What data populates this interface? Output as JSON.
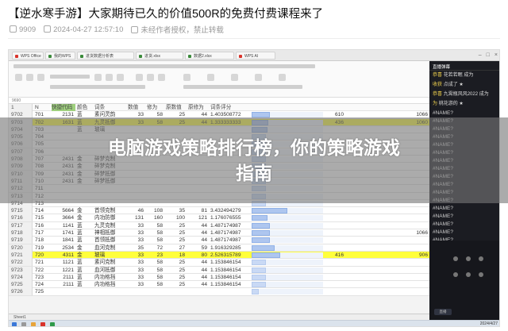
{
  "post": {
    "title": "【逆水寒手游】大家期待已久的价值500R的免费付费课程来了",
    "views": "9909",
    "date": "2024-04-27 12:57:10",
    "copyright": "未经作者授权，禁止转载"
  },
  "overlay": {
    "line1": "电脑游戏策略排行榜，你的策略游戏",
    "line2": "指南"
  },
  "tabs": [
    "WPS Office",
    "我的WPS",
    "进货数据分析表",
    "进货.xlsx",
    "数据2.xlsx",
    "WPS AI"
  ],
  "cell_ref": "9690",
  "header_row": {
    "rn": "1",
    "cols": [
      "N",
      "快捷代码",
      "颜色",
      "词条",
      "数值",
      "修为",
      "原数值",
      "原修为",
      "词条评分",
      "",
      "",
      "",
      ""
    ]
  },
  "rows": [
    {
      "rn": "9702",
      "n": "701",
      "code": "2131",
      "color": "蓝",
      "word": "素问灵韵",
      "v1": "33",
      "v2": "58",
      "v3": "25",
      "v4": "44",
      "score": "1.403508772",
      "bar": 0.25,
      "x1": "610",
      "x2": "1066",
      "hl": false
    },
    {
      "rn": "9703",
      "n": "702",
      "code": "1631",
      "color": "蓝",
      "word": "九灵抵御",
      "v1": "33",
      "v2": "58",
      "v3": "25",
      "v4": "44",
      "score": "1.333333333",
      "bar": 0.23,
      "x1": "436",
      "x2": "1060",
      "hl": true
    },
    {
      "rn": "9704",
      "n": "703",
      "code": "",
      "color": "蓝",
      "word": "玻璃",
      "v1": "",
      "v2": "",
      "v3": "",
      "v4": "",
      "score": "",
      "bar": 0.22,
      "x1": "",
      "x2": "",
      "hl": false
    },
    {
      "rn": "9705",
      "n": "704",
      "code": "",
      "color": "",
      "word": "",
      "v1": "",
      "v2": "",
      "v3": "",
      "v4": "",
      "score": "",
      "bar": 0.2,
      "x1": "",
      "x2": "",
      "hl": false
    },
    {
      "rn": "9706",
      "n": "705",
      "code": "",
      "color": "",
      "word": "",
      "v1": "",
      "v2": "",
      "v3": "",
      "v4": "",
      "score": "",
      "bar": 0.2,
      "x1": "",
      "x2": "",
      "hl": false
    },
    {
      "rn": "9707",
      "n": "706",
      "code": "",
      "color": "",
      "word": "",
      "v1": "",
      "v2": "",
      "v3": "",
      "v4": "",
      "score": "",
      "bar": 0.2,
      "x1": "",
      "x2": "",
      "hl": false
    },
    {
      "rn": "9708",
      "n": "707",
      "code": "2431",
      "color": "金",
      "word": "碎梦克制",
      "v1": "",
      "v2": "",
      "v3": "",
      "v4": "",
      "score": "",
      "bar": 0.2,
      "x1": "",
      "x2": "",
      "hl": false
    },
    {
      "rn": "9709",
      "n": "708",
      "code": "2431",
      "color": "金",
      "word": "碎梦克制",
      "v1": "",
      "v2": "",
      "v3": "",
      "v4": "",
      "score": "",
      "bar": 0.2,
      "x1": "",
      "x2": "",
      "hl": false
    },
    {
      "rn": "9710",
      "n": "709",
      "code": "2431",
      "color": "金",
      "word": "碎梦抵御",
      "v1": "",
      "v2": "",
      "v3": "",
      "v4": "",
      "score": "",
      "bar": 0.2,
      "x1": "",
      "x2": "",
      "hl": false
    },
    {
      "rn": "9711",
      "n": "710",
      "code": "2431",
      "color": "金",
      "word": "碎梦抵御",
      "v1": "",
      "v2": "",
      "v3": "",
      "v4": "",
      "score": "",
      "bar": 0.2,
      "x1": "",
      "x2": "",
      "hl": false
    },
    {
      "rn": "9712",
      "n": "711",
      "code": "",
      "color": "",
      "word": "",
      "v1": "",
      "v2": "",
      "v3": "",
      "v4": "",
      "score": "",
      "bar": 0.2,
      "x1": "",
      "x2": "",
      "hl": false
    },
    {
      "rn": "9713",
      "n": "712",
      "code": "",
      "color": "",
      "word": "",
      "v1": "",
      "v2": "",
      "v3": "",
      "v4": "",
      "score": "",
      "bar": 0.2,
      "x1": "",
      "x2": "",
      "hl": false
    },
    {
      "rn": "9714",
      "n": "713",
      "code": "",
      "color": "",
      "word": "",
      "v1": "",
      "v2": "",
      "v3": "",
      "v4": "",
      "score": "",
      "bar": 0.2,
      "x1": "",
      "x2": "",
      "hl": false
    },
    {
      "rn": "9715",
      "n": "714",
      "code": "5664",
      "color": "金",
      "word": "首领克制",
      "v1": "46",
      "v2": "108",
      "v3": "35",
      "v4": "81",
      "score": "3.432494279",
      "bar": 0.5,
      "x1": "",
      "x2": "",
      "hl": false
    },
    {
      "rn": "9716",
      "n": "715",
      "code": "3664",
      "color": "金",
      "word": "内功防御",
      "v1": "131",
      "v2": "160",
      "v3": "100",
      "v4": "121",
      "score": "1.176076555",
      "bar": 0.22,
      "x1": "",
      "x2": "",
      "hl": false
    },
    {
      "rn": "9717",
      "n": "716",
      "code": "1141",
      "color": "蓝",
      "word": "九灵克制",
      "v1": "33",
      "v2": "58",
      "v3": "25",
      "v4": "44",
      "score": "1.487174987",
      "bar": 0.25,
      "x1": "",
      "x2": "",
      "hl": false
    },
    {
      "rn": "9718",
      "n": "717",
      "code": "1741",
      "color": "蓝",
      "word": "神相抵御",
      "v1": "33",
      "v2": "58",
      "v3": "25",
      "v4": "44",
      "score": "1.487174987",
      "bar": 0.25,
      "x1": "",
      "x2": "1066",
      "hl": false
    },
    {
      "rn": "9719",
      "n": "718",
      "code": "1841",
      "color": "蓝",
      "word": "首领抵御",
      "v1": "33",
      "v2": "58",
      "v3": "25",
      "v4": "44",
      "score": "1.487174987",
      "bar": 0.25,
      "x1": "",
      "x2": "",
      "hl": false
    },
    {
      "rn": "9720",
      "n": "719",
      "code": "2534",
      "color": "金",
      "word": "血河克制",
      "v1": "35",
      "v2": "72",
      "v3": "27",
      "v4": "59",
      "score": "1.916329285",
      "bar": 0.32,
      "x1": "",
      "x2": "",
      "hl": false
    },
    {
      "rn": "9721",
      "n": "720",
      "code": "4311",
      "color": "金",
      "word": "玻璃",
      "v1": "33",
      "v2": "23",
      "v3": "18",
      "v4": "80",
      "score": "2.526315789",
      "bar": 0.4,
      "x1": "416",
      "x2": "906",
      "hl": true
    },
    {
      "rn": "9722",
      "n": "721",
      "code": "1121",
      "color": "蓝",
      "word": "素问克制",
      "v1": "33",
      "v2": "58",
      "v3": "25",
      "v4": "44",
      "score": "1.153846154",
      "bar": 0.2,
      "x1": "",
      "x2": "",
      "hl": false
    },
    {
      "rn": "9723",
      "n": "722",
      "code": "1221",
      "color": "蓝",
      "word": "血河抵御",
      "v1": "33",
      "v2": "58",
      "v3": "25",
      "v4": "44",
      "score": "1.153846154",
      "bar": 0.2,
      "x1": "",
      "x2": "",
      "hl": false
    },
    {
      "rn": "9724",
      "n": "723",
      "code": "2111",
      "color": "蓝",
      "word": "内功格挡",
      "v1": "33",
      "v2": "58",
      "v3": "25",
      "v4": "44",
      "score": "1.153846154",
      "bar": 0.2,
      "x1": "",
      "x2": "",
      "hl": false
    },
    {
      "rn": "9725",
      "n": "724",
      "code": "2111",
      "color": "蓝",
      "word": "内功格挡",
      "v1": "33",
      "v2": "58",
      "v3": "25",
      "v4": "44",
      "score": "1.153846154",
      "bar": 0.2,
      "x1": "",
      "x2": "",
      "hl": false
    },
    {
      "rn": "9726",
      "n": "725",
      "code": "",
      "color": "",
      "word": "",
      "v1": "",
      "v2": "",
      "v3": "",
      "v4": "",
      "score": "",
      "bar": 0.1,
      "x1": "",
      "x2": "",
      "hl": false
    }
  ],
  "sidebar": {
    "header": "直播弹幕",
    "chats": [
      {
        "user": "恭喜",
        "msg": "花若若眠 成为"
      },
      {
        "user": "收获",
        "msg": "点成了 ★"
      },
      {
        "user": "恭喜",
        "msg": "九霄瓶风风2022 成为"
      },
      {
        "user": "为",
        "msg": "桃花游的 ★"
      }
    ],
    "names": [
      "#NAME?",
      "#NAME?",
      "#NAME?",
      "#NAME?",
      "#NAME?",
      "#NAME?",
      "#NAME?",
      "#NAME?",
      "#NAME?",
      "#NAME?",
      "#NAME?",
      "#NAME?",
      "#NAME?",
      "#NAME?",
      "#NAME?",
      "#NAME?",
      "#NAME?",
      "#NAME?",
      "#NAME?",
      "#NAME?"
    ],
    "live_btn": "直播"
  },
  "taskbar": {
    "time": "2024/4/27"
  },
  "sheet_tab": "Sheet1"
}
